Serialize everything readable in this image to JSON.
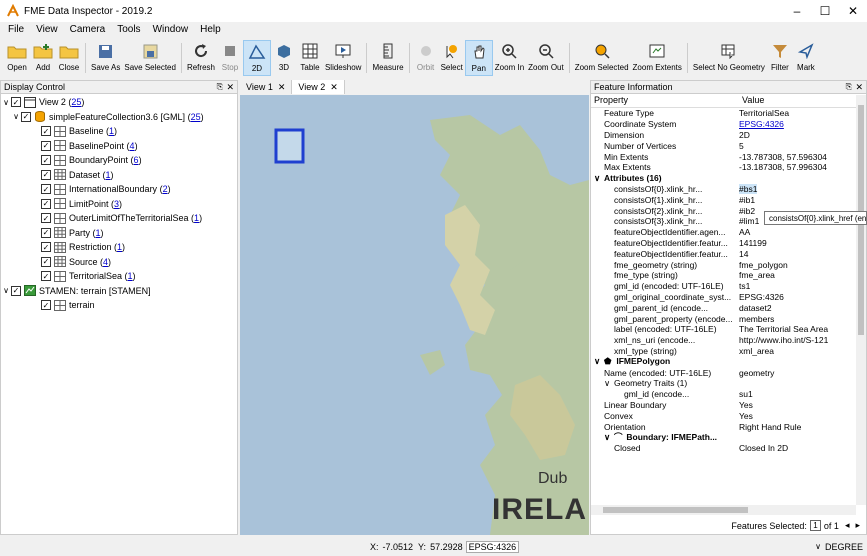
{
  "window": {
    "title": "FME Data Inspector - 2019.2",
    "minimize": "–",
    "maximize": "☐",
    "close": "✕"
  },
  "menu": [
    "File",
    "View",
    "Camera",
    "Tools",
    "Window",
    "Help"
  ],
  "toolbar": [
    {
      "label": "Open"
    },
    {
      "label": "Add"
    },
    {
      "label": "Close"
    },
    {
      "label": "Save As"
    },
    {
      "label": "Save Selected"
    },
    {
      "label": "Refresh"
    },
    {
      "label": "Stop"
    },
    {
      "label": "2D"
    },
    {
      "label": "3D"
    },
    {
      "label": "Table"
    },
    {
      "label": "Slideshow"
    },
    {
      "label": "Measure"
    },
    {
      "label": "Orbit"
    },
    {
      "label": "Select"
    },
    {
      "label": "Pan"
    },
    {
      "label": "Zoom In"
    },
    {
      "label": "Zoom Out"
    },
    {
      "label": "Zoom Selected"
    },
    {
      "label": "Zoom Extents"
    },
    {
      "label": "Select No Geometry"
    },
    {
      "label": "Filter"
    },
    {
      "label": "Mark"
    }
  ],
  "display_control": {
    "header": "Display Control",
    "view": {
      "name": "View 2",
      "count": "25"
    },
    "collection": {
      "name": "simpleFeatureCollection3.6 [GML]",
      "count": "25"
    },
    "layers": [
      {
        "name": "Baseline",
        "count": "1"
      },
      {
        "name": "BaselinePoint",
        "count": "4"
      },
      {
        "name": "BoundaryPoint",
        "count": "6"
      },
      {
        "name": "Dataset",
        "count": "1"
      },
      {
        "name": "InternationalBoundary",
        "count": "2"
      },
      {
        "name": "LimitPoint",
        "count": "3"
      },
      {
        "name": "OuterLimitOfTheTerritorialSea",
        "count": "1"
      },
      {
        "name": "Party",
        "count": "1"
      },
      {
        "name": "Restriction",
        "count": "1"
      },
      {
        "name": "Source",
        "count": "4"
      },
      {
        "name": "TerritorialSea",
        "count": "1"
      }
    ],
    "basemap": {
      "name": "STAMEN: terrain [STAMEN]",
      "child": "terrain"
    }
  },
  "views": {
    "tabs": [
      "View 1",
      "View 2"
    ],
    "map_labels": {
      "dublin": "Dub",
      "ireland": "IRELAN"
    }
  },
  "feature_info": {
    "header": "Feature Information",
    "col_property": "Property",
    "col_value": "Value",
    "rows": [
      {
        "k": "Feature Type",
        "v": "TerritorialSea",
        "indent": 1
      },
      {
        "k": "Coordinate System",
        "v": "EPSG:4326",
        "indent": 1,
        "link": true
      },
      {
        "k": "Dimension",
        "v": "2D",
        "indent": 1
      },
      {
        "k": "Number of Vertices",
        "v": "5",
        "indent": 1
      },
      {
        "k": "Min Extents",
        "v": "-13.787308, 57.596304",
        "indent": 1
      },
      {
        "k": "Max Extents",
        "v": "-13.187308, 57.996304",
        "indent": 1
      },
      {
        "k": "Attributes (16)",
        "v": "",
        "indent": 0,
        "bold": true,
        "expander": "∨"
      },
      {
        "k": "consistsOf{0}.xlink_hr...",
        "v": "#bs1",
        "indent": 2,
        "vsel": true
      },
      {
        "k": "consistsOf{1}.xlink_hr...",
        "v": "#ib1",
        "indent": 2
      },
      {
        "k": "consistsOf{2}.xlink_hr...",
        "v": "#ib2",
        "indent": 2
      },
      {
        "k": "consistsOf{3}.xlink_hr...",
        "v": "#lim1",
        "indent": 2
      },
      {
        "k": "featureObjectIdentifier.agen...",
        "v": "AA",
        "indent": 2
      },
      {
        "k": "featureObjectIdentifier.featur...",
        "v": "141199",
        "indent": 2
      },
      {
        "k": "featureObjectIdentifier.featur...",
        "v": "14",
        "indent": 2
      },
      {
        "k": "fme_geometry (string)",
        "v": "fme_polygon",
        "indent": 2
      },
      {
        "k": "fme_type (string)",
        "v": "fme_area",
        "indent": 2
      },
      {
        "k": "gml_id (encoded: UTF-16LE)",
        "v": "ts1",
        "indent": 2
      },
      {
        "k": "gml_original_coordinate_syst...",
        "v": "EPSG:4326",
        "indent": 2
      },
      {
        "k": "gml_parent_id (encode...",
        "v": "dataset2",
        "indent": 2
      },
      {
        "k": "gml_parent_property (encode...",
        "v": "members",
        "indent": 2
      },
      {
        "k": "label (encoded: UTF-16LE)",
        "v": "The Territorial Sea Area",
        "indent": 2
      },
      {
        "k": "xml_ns_uri (encode...",
        "v": "http://www.iho.int/S-121",
        "indent": 2
      },
      {
        "k": "xml_type (string)",
        "v": "xml_area",
        "indent": 2
      },
      {
        "k": "IFMEPolygon",
        "v": "",
        "indent": 0,
        "bold": true,
        "expander": "∨",
        "icon": "polygon"
      },
      {
        "k": "Name (encoded: UTF-16LE)",
        "v": "geometry",
        "indent": 1
      },
      {
        "k": "Geometry Traits (1)",
        "v": "",
        "indent": 1,
        "expander": "∨"
      },
      {
        "k": "gml_id (encode...",
        "v": "su1",
        "indent": 3
      },
      {
        "k": "Linear Boundary",
        "v": "Yes",
        "indent": 1
      },
      {
        "k": "Convex",
        "v": "Yes",
        "indent": 1
      },
      {
        "k": "Orientation",
        "v": "Right Hand Rule",
        "indent": 1
      },
      {
        "k": "Boundary: IFMEPath...",
        "v": "",
        "indent": 1,
        "bold": true,
        "expander": "∨",
        "icon": "path"
      },
      {
        "k": "Closed",
        "v": "Closed In 2D",
        "indent": 2
      }
    ],
    "tooltip": "consistsOf{0}.xlink_href (en",
    "features_selected_label": "Features Selected:",
    "page_current": "1",
    "page_of": "of 1"
  },
  "status": {
    "x_label": "X:",
    "x": "-7.0512",
    "y_label": "Y:",
    "y": "57.2928",
    "crs": "EPSG:4326",
    "unit": "DEGREE"
  }
}
